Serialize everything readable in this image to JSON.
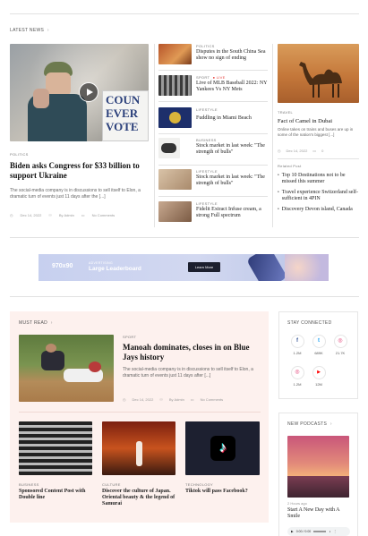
{
  "latest": {
    "section_title": "LATEST NEWS",
    "lead": {
      "category": "POLITICS",
      "title": "Biden asks Congress for $33 billion to support Ukraine",
      "excerpt": "The social-media company is in discussions to sell itself to Elon, a dramatic turn of events just 11 days after the [...]",
      "date": "Dec 14, 2022",
      "author": "By Admin",
      "comments": "No Comments",
      "sign_text": [
        "COUN",
        "EVER",
        "VOTE"
      ]
    },
    "list": [
      {
        "category": "POLITICS",
        "title": "Disputes in the South China Sea show no sign of ending",
        "live": ""
      },
      {
        "category": "SPORT",
        "title": "Live of MLB Baseball 2022: NY Yankees Vs NY Mets",
        "live": "LIVE"
      },
      {
        "category": "LIFESTYLE",
        "title": "Fuddling in Miami Beach",
        "live": ""
      },
      {
        "category": "BUSINESS",
        "title": "Stock market in last week: \"The strength of bulls\"",
        "live": ""
      },
      {
        "category": "LIFESTYLE",
        "title": "Stock market in last week: \"The strength of bulls\"",
        "live": ""
      },
      {
        "category": "LIFESTYLE",
        "title": "Fidelit Extract Infuse cream, a strong Full spectrum",
        "live": ""
      }
    ],
    "travel": {
      "category": "TRAVEL",
      "title": "Fact of Camel in Dubai",
      "excerpt": "Online takes on trains and buses are up in some of the nation's biggest [...]",
      "date": "Dec 14, 2022",
      "comments": "0"
    },
    "related": {
      "label": "Related Post",
      "items": [
        "Top 10 Destinations not to be missed this summer",
        "Travel experience Switzerland self-sufficient in 4PIN",
        "Discovery Devon island, Canada"
      ]
    }
  },
  "ad": {
    "size": "970x90",
    "eyebrow": "ADVERTISING",
    "title": "Large Leaderboard",
    "button": "Learn More"
  },
  "must_read": {
    "section_title": "MUST READ",
    "feature": {
      "category": "SPORT",
      "title": "Manoah dominates, closes in on Blue Jays history",
      "excerpt": "The social-media company is in discussions to sell itself to Elon, a dramatic turn of events just 11 days after [...]",
      "date": "Dec 14, 2022",
      "author": "By Admin",
      "comments": "No Comments"
    },
    "cards": [
      {
        "category": "BUSINESS",
        "title": "Sponsored Content Post with Double line"
      },
      {
        "category": "CULTURE",
        "title": "Discover the culture of Japan. Oriental beauty & the legend of Samurai"
      },
      {
        "category": "TECHNOLOGY",
        "title": "Tiktok will pass Facebook?"
      }
    ]
  },
  "stay_connected": {
    "title": "STAY CONNECTED",
    "items": [
      {
        "icon": "facebook-icon",
        "glyph": "f",
        "count": "1.2M",
        "color": "#3b5998"
      },
      {
        "icon": "twitter-icon",
        "glyph": "t",
        "count": "689K",
        "color": "#1da1f2"
      },
      {
        "icon": "instagram-icon",
        "glyph": "◎",
        "count": "21.7K",
        "color": "#e1306c"
      },
      {
        "icon": "instagram-icon",
        "glyph": "◎",
        "count": "1.2M",
        "color": "#e1306c"
      },
      {
        "icon": "youtube-icon",
        "glyph": "▶",
        "count": "12M",
        "color": "#ff0000"
      }
    ]
  },
  "podcasts": {
    "title": "NEW PODCASTS",
    "meta": "2 Hours ago",
    "episode_title": "Start A New Day with A Smile",
    "player_time": "0:00 / 0:00"
  }
}
